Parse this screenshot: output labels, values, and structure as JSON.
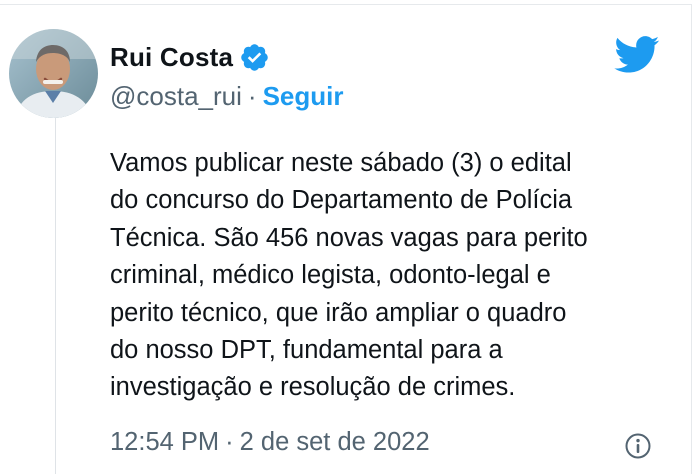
{
  "author": {
    "display_name": "Rui Costa",
    "handle": "@costa_rui",
    "verified_icon": "verified-badge-icon",
    "avatar_icon": "avatar-photo"
  },
  "actions": {
    "separator": "·",
    "follow_label": "Seguir"
  },
  "tweet": {
    "text": "Vamos publicar neste sábado (3) o edital\ndo concurso do Departamento de Polícia\nTécnica. São 456 novas vagas para perito\ncriminal, médico legista, odonto-legal e\nperito técnico, que irão ampliar o quadro\ndo nosso DPT, fundamental para a\ninvestigação e resolução de crimes.",
    "time": "12:54 PM",
    "meta_separator": "·",
    "date": "2 de set de 2022"
  },
  "icons": {
    "brand": "twitter-bird-icon",
    "info": "info-icon"
  },
  "colors": {
    "accent": "#1d9bf0",
    "text": "#0f1419",
    "secondary": "#536471",
    "border": "#e6e9ec"
  }
}
